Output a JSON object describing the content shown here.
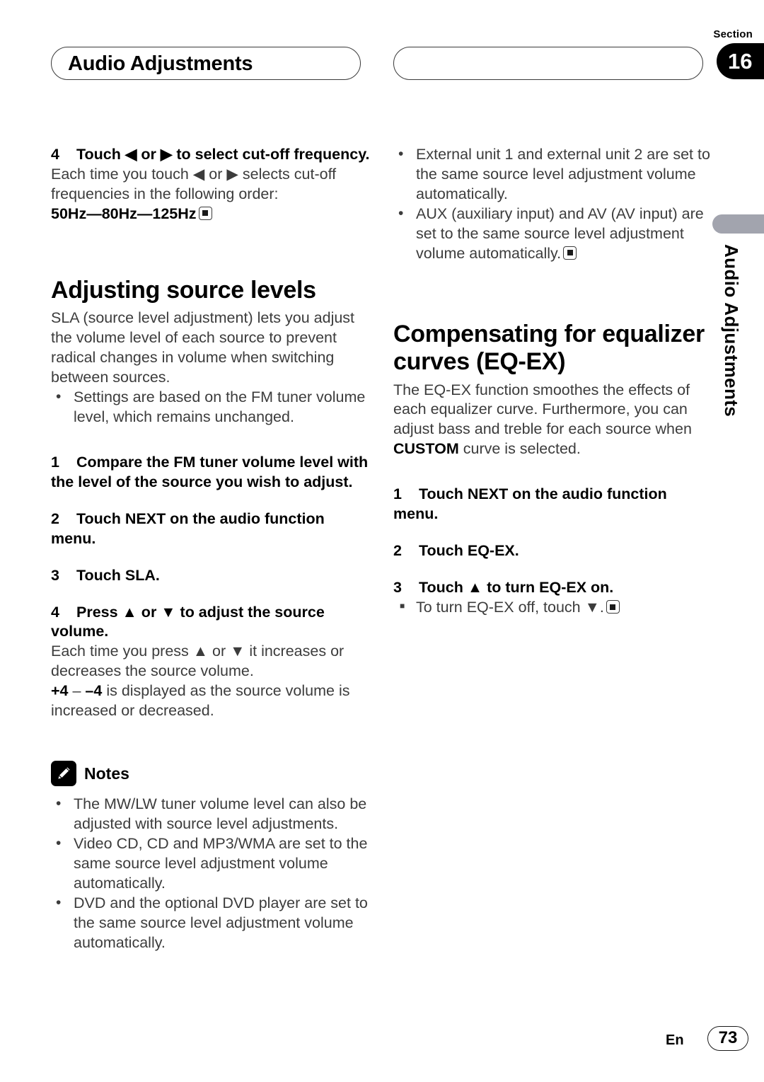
{
  "header": {
    "left_title": "Audio Adjustments",
    "right_title": "",
    "section_label": "Section",
    "section_number": "16"
  },
  "side_tab": {
    "label": "Audio Adjustments"
  },
  "left_column": {
    "step4": {
      "number": "4",
      "text": "Touch ◀ or ▶ to select cut-off frequency."
    },
    "step4_body": "Each time you touch ◀ or ▶ selects cut-off frequencies in the following order:",
    "step4_order": "50Hz—80Hz—125Hz",
    "heading": "Adjusting source levels",
    "intro": "SLA (source level adjustment) lets you adjust the volume level of each source to prevent radical changes in volume when switching between sources.",
    "intro_bullets": [
      "Settings are based on the FM tuner volume level, which remains unchanged."
    ],
    "steps": [
      {
        "number": "1",
        "text": "Compare the FM tuner volume level with the level of the source you wish to adjust."
      },
      {
        "number": "2",
        "text": "Touch NEXT on the audio function menu."
      },
      {
        "number": "3",
        "text": "Touch SLA."
      },
      {
        "number": "4",
        "text": "Press ▲ or ▼ to adjust the source volume."
      }
    ],
    "step4b_body": "Each time you press ▲ or ▼ it increases or decreases the source volume.",
    "range_bold": "+4",
    "range_dash": " – ",
    "range_bold2": "–4",
    "range_rest": " is displayed as the source volume is increased or decreased.",
    "notes_label": "Notes",
    "notes": [
      "The MW/LW tuner volume level can also be adjusted with source level adjustments.",
      "Video CD, CD and MP3/WMA are set to the same source level adjustment volume automatically.",
      "DVD and the optional DVD player are set to the same source level adjustment volume automatically."
    ]
  },
  "right_column": {
    "top_bullets": [
      "External unit 1 and external unit 2 are set to the same source level adjustment volume automatically.",
      "AUX (auxiliary input) and AV (AV input) are set to the same source level adjustment volume automatically."
    ],
    "heading": "Compensating for equalizer curves (EQ-EX)",
    "intro_a": "The EQ-EX function smoothes the effects of each equalizer curve. Furthermore, you can adjust bass and treble for each source when ",
    "intro_bold": "CUSTOM",
    "intro_b": " curve is selected.",
    "steps": [
      {
        "number": "1",
        "text": "Touch NEXT on the audio function menu."
      },
      {
        "number": "2",
        "text": "Touch EQ-EX."
      },
      {
        "number": "3",
        "text": "Touch ▲ to turn EQ-EX on."
      }
    ],
    "sub_bullets": [
      "To turn EQ-EX off, touch ▼."
    ]
  },
  "footer": {
    "language": "En",
    "page_number": "73"
  }
}
